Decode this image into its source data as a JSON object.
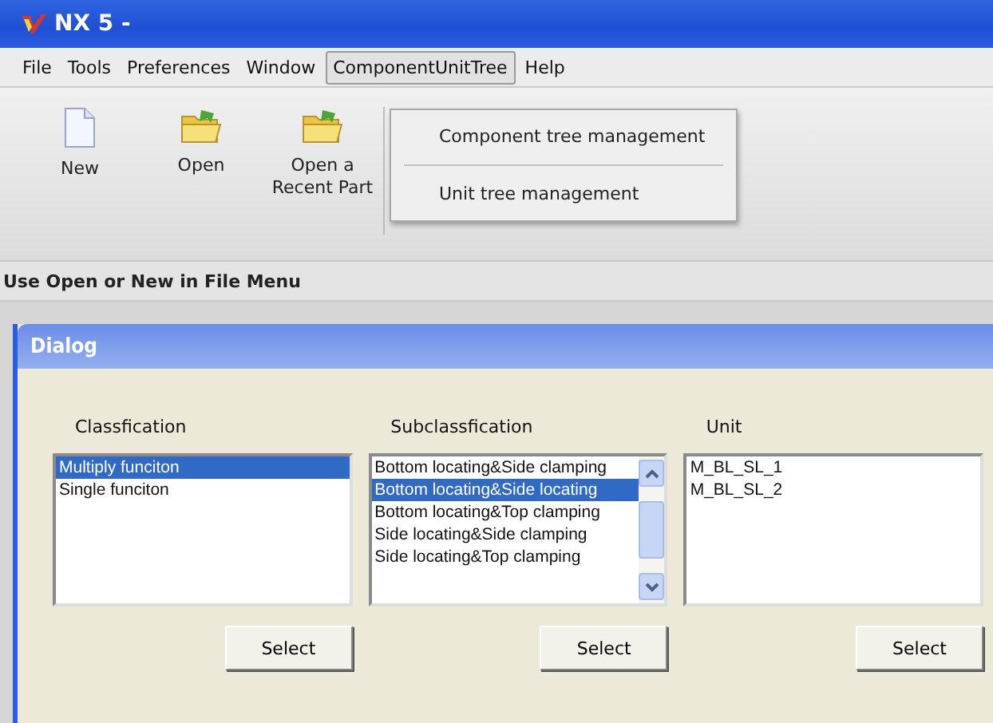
{
  "window": {
    "title": "NX 5 -"
  },
  "menu_bar": [
    {
      "label": "File",
      "selected": false
    },
    {
      "label": "Tools",
      "selected": false
    },
    {
      "label": "Preferences",
      "selected": false
    },
    {
      "label": "Window",
      "selected": false
    },
    {
      "label": "ComponentUnitTree",
      "selected": true
    },
    {
      "label": "Help",
      "selected": false
    }
  ],
  "open_menu": {
    "items": [
      "Component tree management",
      "Unit tree management"
    ]
  },
  "toolbar": [
    {
      "label": "New",
      "kind": "document"
    },
    {
      "label": "Open",
      "kind": "folder"
    },
    {
      "label": "Open a Recent Part",
      "kind": "folder"
    }
  ],
  "status": "Use Open or New in File Menu",
  "dialog": {
    "title": "Dialog",
    "columns": [
      {
        "heading": "Classfication",
        "scrollable": false,
        "button": "Select",
        "items": [
          {
            "text": "Multiply funciton",
            "selected": true
          },
          {
            "text": "Single funciton",
            "selected": false
          }
        ]
      },
      {
        "heading": "Subclassfication",
        "scrollable": true,
        "button": "Select",
        "items": [
          {
            "text": "Bottom locating&Side clamping",
            "selected": false
          },
          {
            "text": "Bottom locating&Side locating",
            "selected": true
          },
          {
            "text": "Bottom locating&Top clamping",
            "selected": false
          },
          {
            "text": "Side locating&Side clamping",
            "selected": false
          },
          {
            "text": "Side locating&Top clamping",
            "selected": false
          }
        ]
      },
      {
        "heading": "Unit",
        "scrollable": false,
        "button": "Select",
        "items": [
          {
            "text": "M_BL_SL_1",
            "selected": false
          },
          {
            "text": "M_BL_SL_2",
            "selected": false
          }
        ]
      }
    ]
  }
}
